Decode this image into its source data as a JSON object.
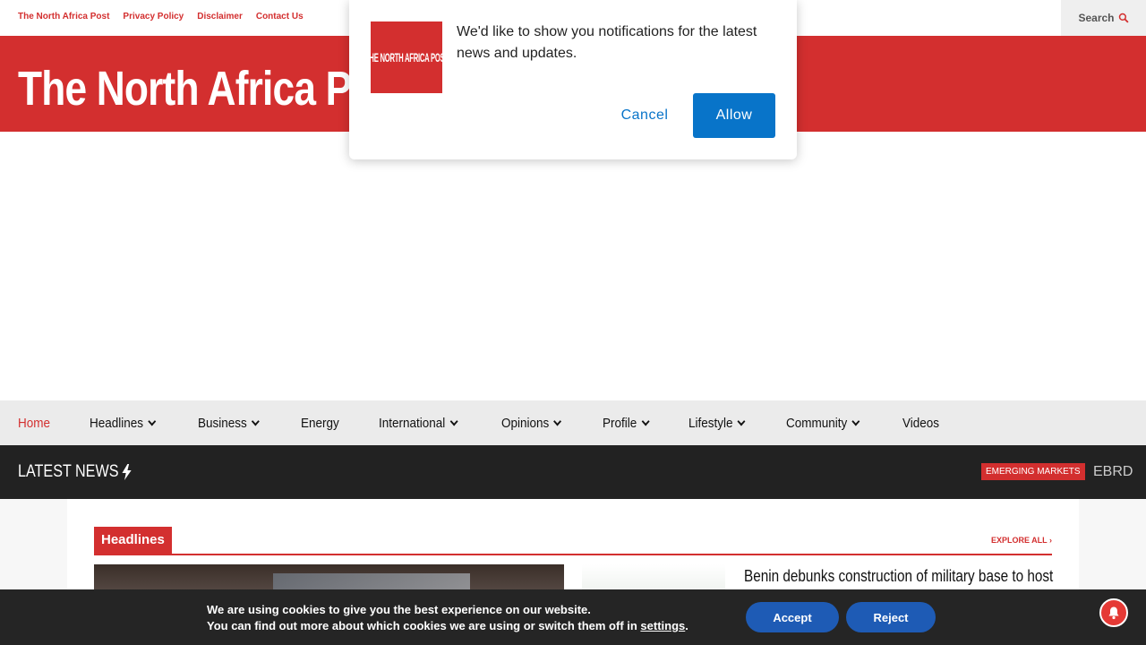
{
  "topbar": {
    "links": [
      "The North Africa Post",
      "Privacy Policy",
      "Disclaimer",
      "Contact Us"
    ],
    "search_label": "Search"
  },
  "header": {
    "site_title": "The North Africa Post"
  },
  "nav": {
    "items": [
      {
        "label": "Home",
        "active": true,
        "dropdown": false
      },
      {
        "label": "Headlines",
        "dropdown": true
      },
      {
        "label": "Business",
        "dropdown": true
      },
      {
        "label": "Energy",
        "dropdown": false
      },
      {
        "label": "International",
        "dropdown": true
      },
      {
        "label": "Opinions",
        "dropdown": true
      },
      {
        "label": "Profile",
        "dropdown": true
      },
      {
        "label": "Lifestyle",
        "dropdown": true
      },
      {
        "label": "Community",
        "dropdown": true
      },
      {
        "label": "Videos",
        "dropdown": false
      }
    ]
  },
  "ticker": {
    "label": "LATEST NEWS",
    "badge": "EMERGING MARKETS",
    "text": "EBRD"
  },
  "section": {
    "tag": "Headlines",
    "explore": "EXPLORE ALL",
    "headline": "Benin debunks construction of military base to host"
  },
  "notification": {
    "logo_text": "THE NORTH AFRICA POST",
    "message": "We'd like to show you notifications for the latest news and updates.",
    "cancel": "Cancel",
    "allow": "Allow"
  },
  "cookie": {
    "line1": "We are using cookies to give you the best experience on our website.",
    "line2_prefix": "You can find out more about which cookies we are using or switch them off in ",
    "settings_link": "settings",
    "line2_suffix": ".",
    "accept": "Accept",
    "reject": "Reject"
  },
  "colors": {
    "brand_red": "#d32f2f",
    "allow_blue": "#0874c9",
    "cookie_blue": "#1e5bb5",
    "dark_bar": "#222222"
  }
}
